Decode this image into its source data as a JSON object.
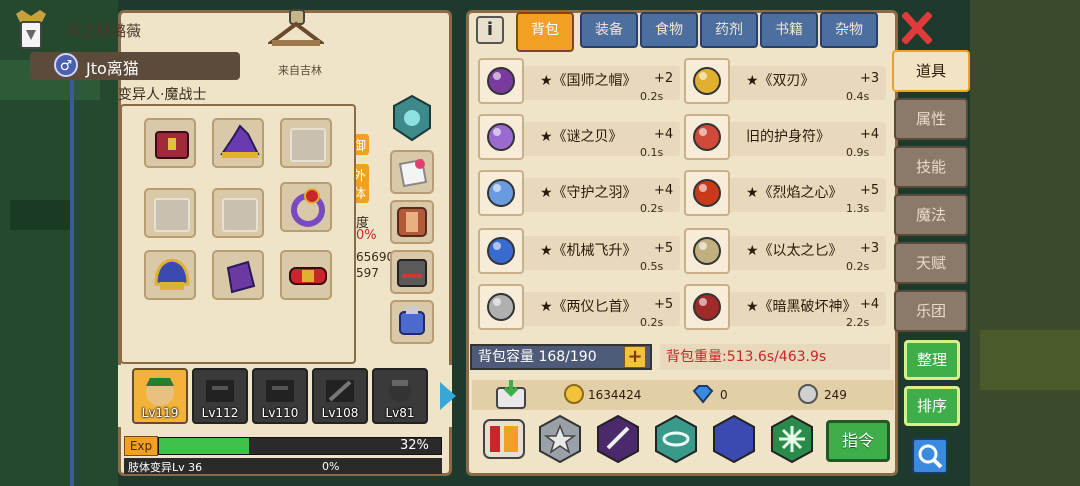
{
  "hero": {
    "nickname": "风之璐璐薇",
    "name": "Jto离猫",
    "gender_symbol": "♂",
    "origin": "来自吉林",
    "class": "变异人·魔战士",
    "stat_tag_1": "御",
    "stat_tag_2": "外",
    "stat_tag_3": "体",
    "stat_label": "度",
    "stat_pct": "0%",
    "stat_num_1": "65690",
    "stat_num_2": "597"
  },
  "team": [
    {
      "level": "Lv119",
      "selected": true
    },
    {
      "level": "Lv112",
      "selected": false
    },
    {
      "level": "Lv110",
      "selected": false
    },
    {
      "level": "Lv108",
      "selected": false
    },
    {
      "level": "Lv81",
      "selected": false
    }
  ],
  "exp": {
    "label": "Exp",
    "percent": 32,
    "percent_text": "32%"
  },
  "skill": {
    "label": "肢体变异Lv 36",
    "percent_text": "0%",
    "percent": 0
  },
  "tabs": [
    {
      "label": "背包",
      "active": true
    },
    {
      "label": "装备",
      "active": false
    },
    {
      "label": "食物",
      "active": false
    },
    {
      "label": "药剂",
      "active": false
    },
    {
      "label": "书籍",
      "active": false
    },
    {
      "label": "杂物",
      "active": false
    }
  ],
  "items": [
    {
      "name": "★《国师之帽》",
      "count": "+2",
      "weight": "0.2s",
      "icon": "wizard-hat-icon"
    },
    {
      "name": "★《双刃》",
      "count": "+3",
      "weight": "0.4s",
      "icon": "amulet-icon"
    },
    {
      "name": "★《谜之贝》",
      "count": "+4",
      "weight": "0.1s",
      "icon": "shell-icon"
    },
    {
      "name": "旧的护身符》",
      "count": "+4",
      "weight": "0.9s",
      "icon": "charm-icon"
    },
    {
      "name": "★《守护之羽》",
      "count": "+4",
      "weight": "0.2s",
      "icon": "feather-icon"
    },
    {
      "name": "★《烈焰之心》",
      "count": "+5",
      "weight": "1.3s",
      "icon": "flame-heart-icon"
    },
    {
      "name": "★《机械飞升》",
      "count": "+5",
      "weight": "0.5s",
      "icon": "mech-wing-icon"
    },
    {
      "name": "★《以太之匕》",
      "count": "+3",
      "weight": "0.2s",
      "icon": "ether-dagger-icon"
    },
    {
      "name": "★《两仪匕首》",
      "count": "+5",
      "weight": "0.2s",
      "icon": "dagger-icon"
    },
    {
      "name": "★《暗黑破坏神》",
      "count": "+4",
      "weight": "2.2s",
      "icon": "dark-sword-icon"
    }
  ],
  "bag": {
    "capacity_text": "背包容量 168/190",
    "weight_text": "背包重量:513.6s/463.9s"
  },
  "resources": {
    "gold": "1634424",
    "diamond": "0",
    "silver": "249"
  },
  "command_label": "指令",
  "nav": [
    {
      "label": "道具",
      "active": true
    },
    {
      "label": "属性",
      "active": false
    },
    {
      "label": "技能",
      "active": false
    },
    {
      "label": "魔法",
      "active": false
    },
    {
      "label": "天赋",
      "active": false
    },
    {
      "label": "乐团",
      "active": false
    }
  ],
  "actions": {
    "arrange": "整理",
    "sort": "排序"
  },
  "colors": {
    "accent_orange": "#f2a023",
    "tab_blue": "#4d6fa0",
    "panel_bg": "#efe3c8",
    "green": "#3fae4a",
    "weight_red": "#c8262a"
  }
}
